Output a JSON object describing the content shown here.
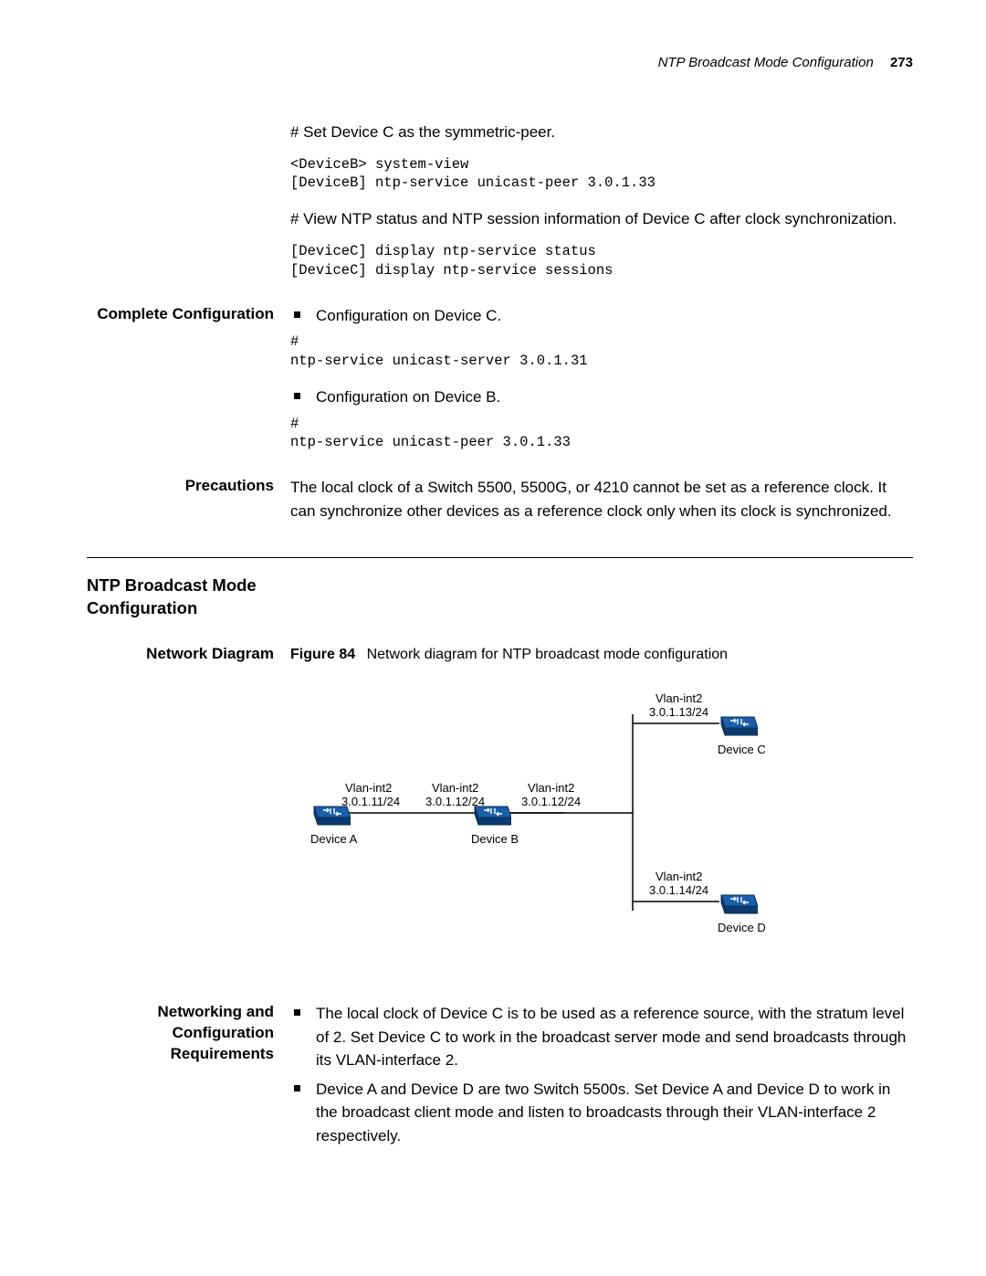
{
  "header": {
    "title": "NTP Broadcast Mode Configuration",
    "page_number": "273"
  },
  "intro": {
    "step1": "# Set Device C as the symmetric-peer.",
    "code1": "<DeviceB> system-view\n[DeviceB] ntp-service unicast-peer 3.0.1.33",
    "step2": "# View NTP status and NTP session information of Device C after clock synchronization.",
    "code2": "[DeviceC] display ntp-service status\n[DeviceC] display ntp-service sessions"
  },
  "complete_config": {
    "label": "Complete Configuration",
    "item1": "Configuration on Device C.",
    "code1": "#\nntp-service unicast-server 3.0.1.31",
    "item2": "Configuration on Device B.",
    "code2": "#\nntp-service unicast-peer 3.0.1.33"
  },
  "precautions": {
    "label": "Precautions",
    "text": "The local clock of a Switch 5500, 5500G, or 4210 cannot be set as a reference clock. It can synchronize other devices as a reference clock only when its clock is synchronized."
  },
  "section_heading": "NTP Broadcast Mode Configuration",
  "network_diagram": {
    "label": "Network Diagram",
    "fig_label": "Figure 84",
    "fig_text": "Network diagram for NTP broadcast mode configuration",
    "nodes": {
      "a": {
        "name": "Device A",
        "iface": "Vlan-int2",
        "addr": "3.0.1.11/24"
      },
      "b": {
        "name": "Device B",
        "iface_left": "Vlan-int2",
        "addr_left": "3.0.1.12/24",
        "iface_right": "Vlan-int2",
        "addr_right": "3.0.1.12/24"
      },
      "c": {
        "name": "Device C",
        "iface": "Vlan-int2",
        "addr": "3.0.1.13/24"
      },
      "d": {
        "name": "Device D",
        "iface": "Vlan-int2",
        "addr": "3.0.1.14/24"
      }
    }
  },
  "requirements": {
    "label": "Networking and Configuration Requirements",
    "item1": "The local clock of Device C is to be used as a reference source, with the stratum level of 2. Set Device C to work in the broadcast server mode and send broadcasts through its VLAN-interface 2.",
    "item2": "Device A and Device D are two Switch 5500s. Set Device A and Device D to work in the broadcast client mode and listen to broadcasts through their VLAN-interface 2 respectively."
  }
}
